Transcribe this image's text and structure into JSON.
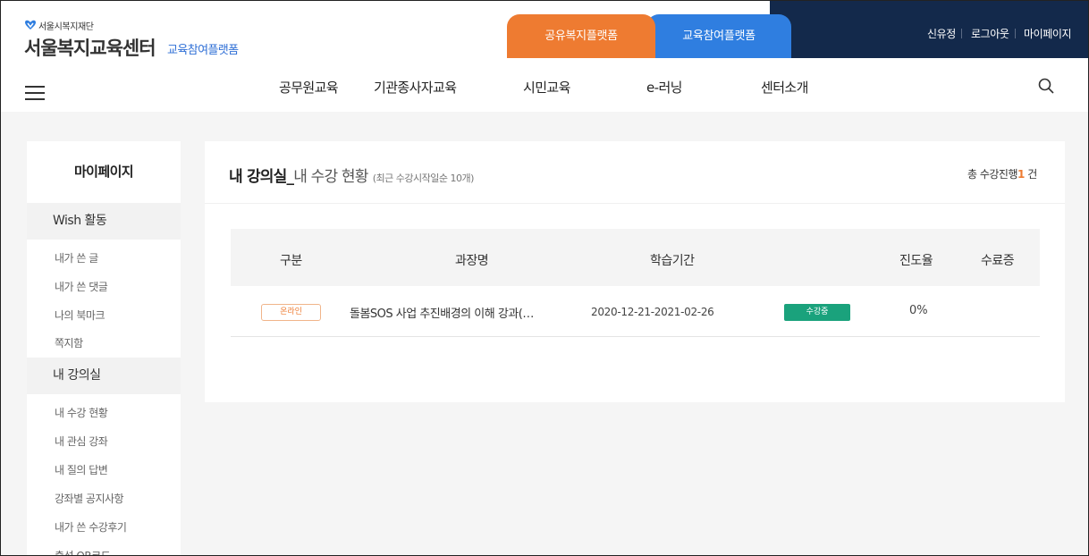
{
  "header": {
    "org_small": "서울시복지재단",
    "site_title": "서울복지교육센터",
    "site_subtitle": "교육참여플랫폼",
    "tabs": [
      {
        "label": "공유복지플랫폼",
        "color": "#ee7b31"
      },
      {
        "label": "교육참여플랫폼",
        "color": "#2f7ee0"
      }
    ],
    "util_links": [
      "신유정",
      "로그아웃",
      "마이페이지"
    ]
  },
  "gnb": {
    "items": [
      "공무원교육",
      "기관종사자교육",
      "시민교육",
      "e-러닝",
      "센터소개"
    ],
    "menu_icon": "hamburger-icon",
    "search_icon": "search-icon"
  },
  "sidebar": {
    "title": "마이페이지",
    "groups": [
      {
        "label": "Wish 활동",
        "items": [
          "내가 쓴 글",
          "내가 쓴 댓글",
          "나의 북마크",
          "쪽지함"
        ]
      },
      {
        "label": "내 강의실",
        "items": [
          "내 수강 현황",
          "내 관심 강좌",
          "내 질의 답변",
          "강좌별 공지사항",
          "내가 쓴 수강후기",
          "출석 QR코드"
        ]
      }
    ]
  },
  "main": {
    "title_bold": "내 강의실_",
    "title_thin": "내 수강 현황",
    "title_note": "(최근 수강시작일순 10개)",
    "total_prefix": "총 수강진행",
    "total_count": "1",
    "total_suffix": "건",
    "table": {
      "headers": [
        "구분",
        "과장명",
        "학습기간",
        "진도율",
        "수료증"
      ],
      "rows": [
        {
          "type": "온라인",
          "course": "돌봄SOS 사업 추진배경의 이해 강과(…",
          "period": "2020-12-21-2021-02-26",
          "status": "수강중",
          "progress": "0%",
          "certificate": ""
        }
      ]
    }
  }
}
